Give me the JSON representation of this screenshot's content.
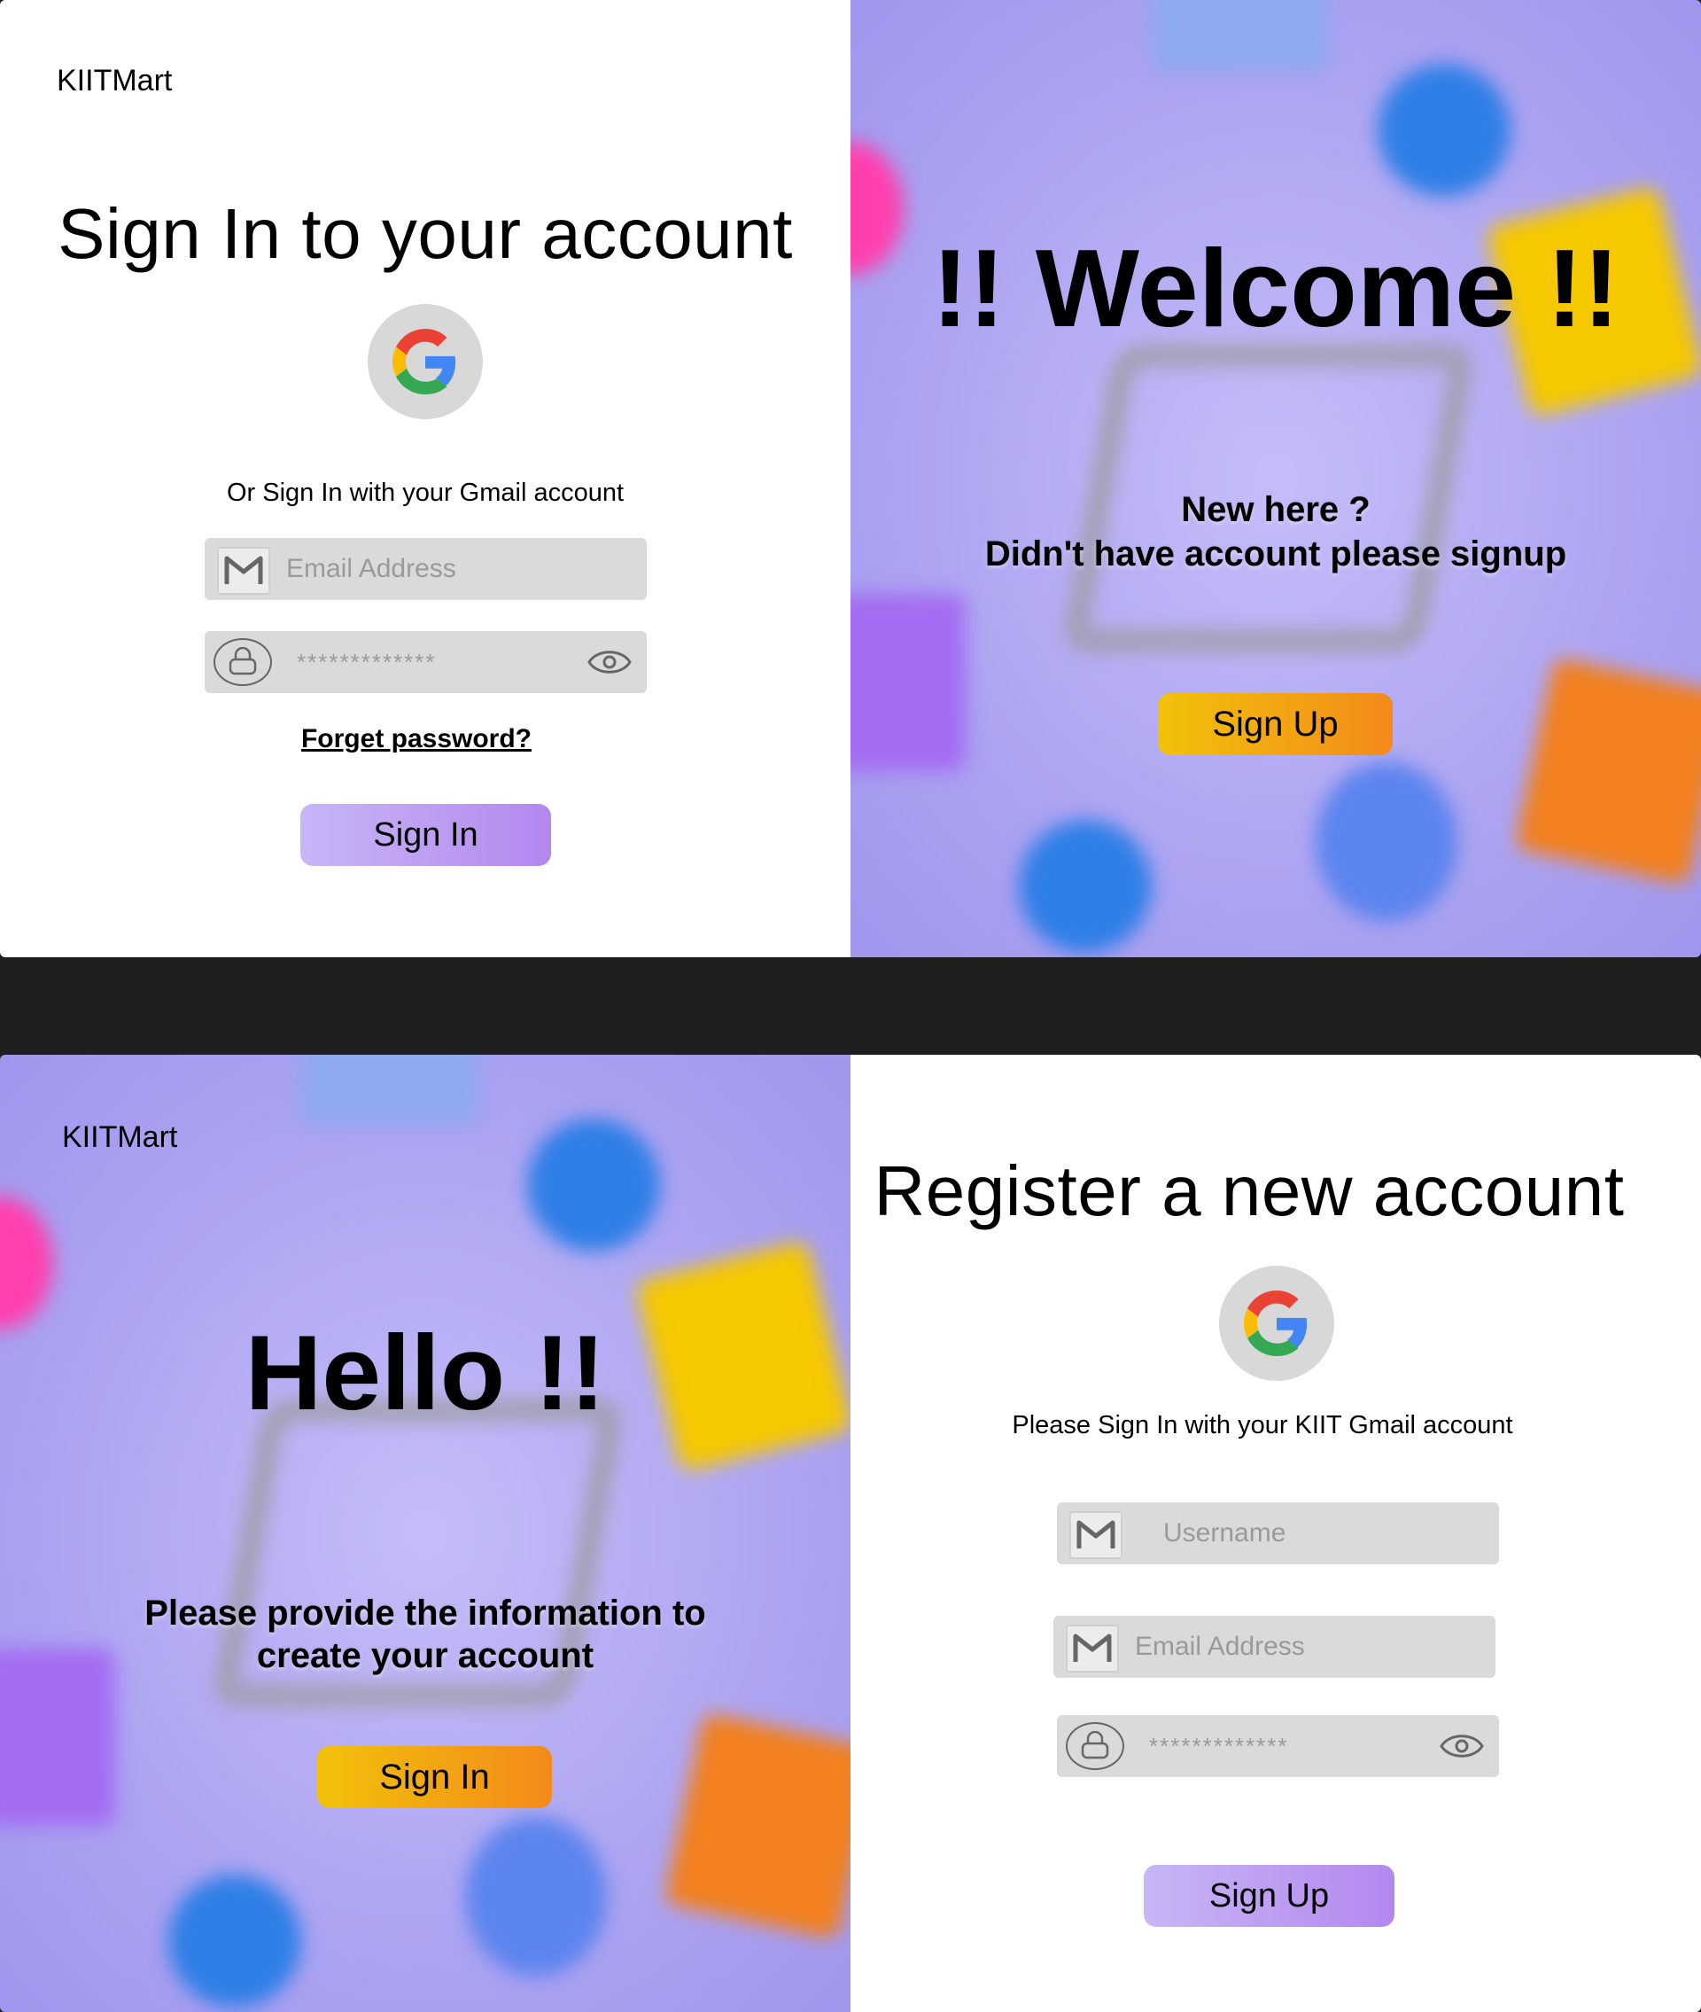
{
  "signin": {
    "brand": "KIITMart",
    "title": "Sign In to your account",
    "gmail_hint": "Or Sign In with your Gmail account",
    "email_placeholder": "Email Address",
    "password_value": "*************",
    "forgot_link": "Forget password?",
    "submit_label": "Sign In",
    "promo": {
      "title": "!!  Welcome  !!",
      "line1": "New here ?",
      "line2": "Didn't have account please signup",
      "button_label": "Sign Up"
    }
  },
  "register": {
    "brand": "KIITMart",
    "promo": {
      "title": "Hello !!",
      "line1": "Please provide the information to",
      "line2": "create your account",
      "button_label": "Sign In"
    },
    "title": "Register a new account",
    "gmail_hint": "Please Sign In with your KIIT Gmail account",
    "username_placeholder": "Username",
    "email_placeholder": "Email Address",
    "password_value": "*************",
    "submit_label": "Sign Up"
  },
  "colors": {
    "purple_button": "#b388ef",
    "orange_button_start": "#f2c20a",
    "orange_button_end": "#f38a1a",
    "promo_background": "#ada4f2",
    "field_background": "#dadada",
    "page_separator": "#1f1f1f"
  },
  "icons": [
    "google-logo-icon",
    "gmail-icon",
    "lock-icon",
    "eye-icon"
  ]
}
